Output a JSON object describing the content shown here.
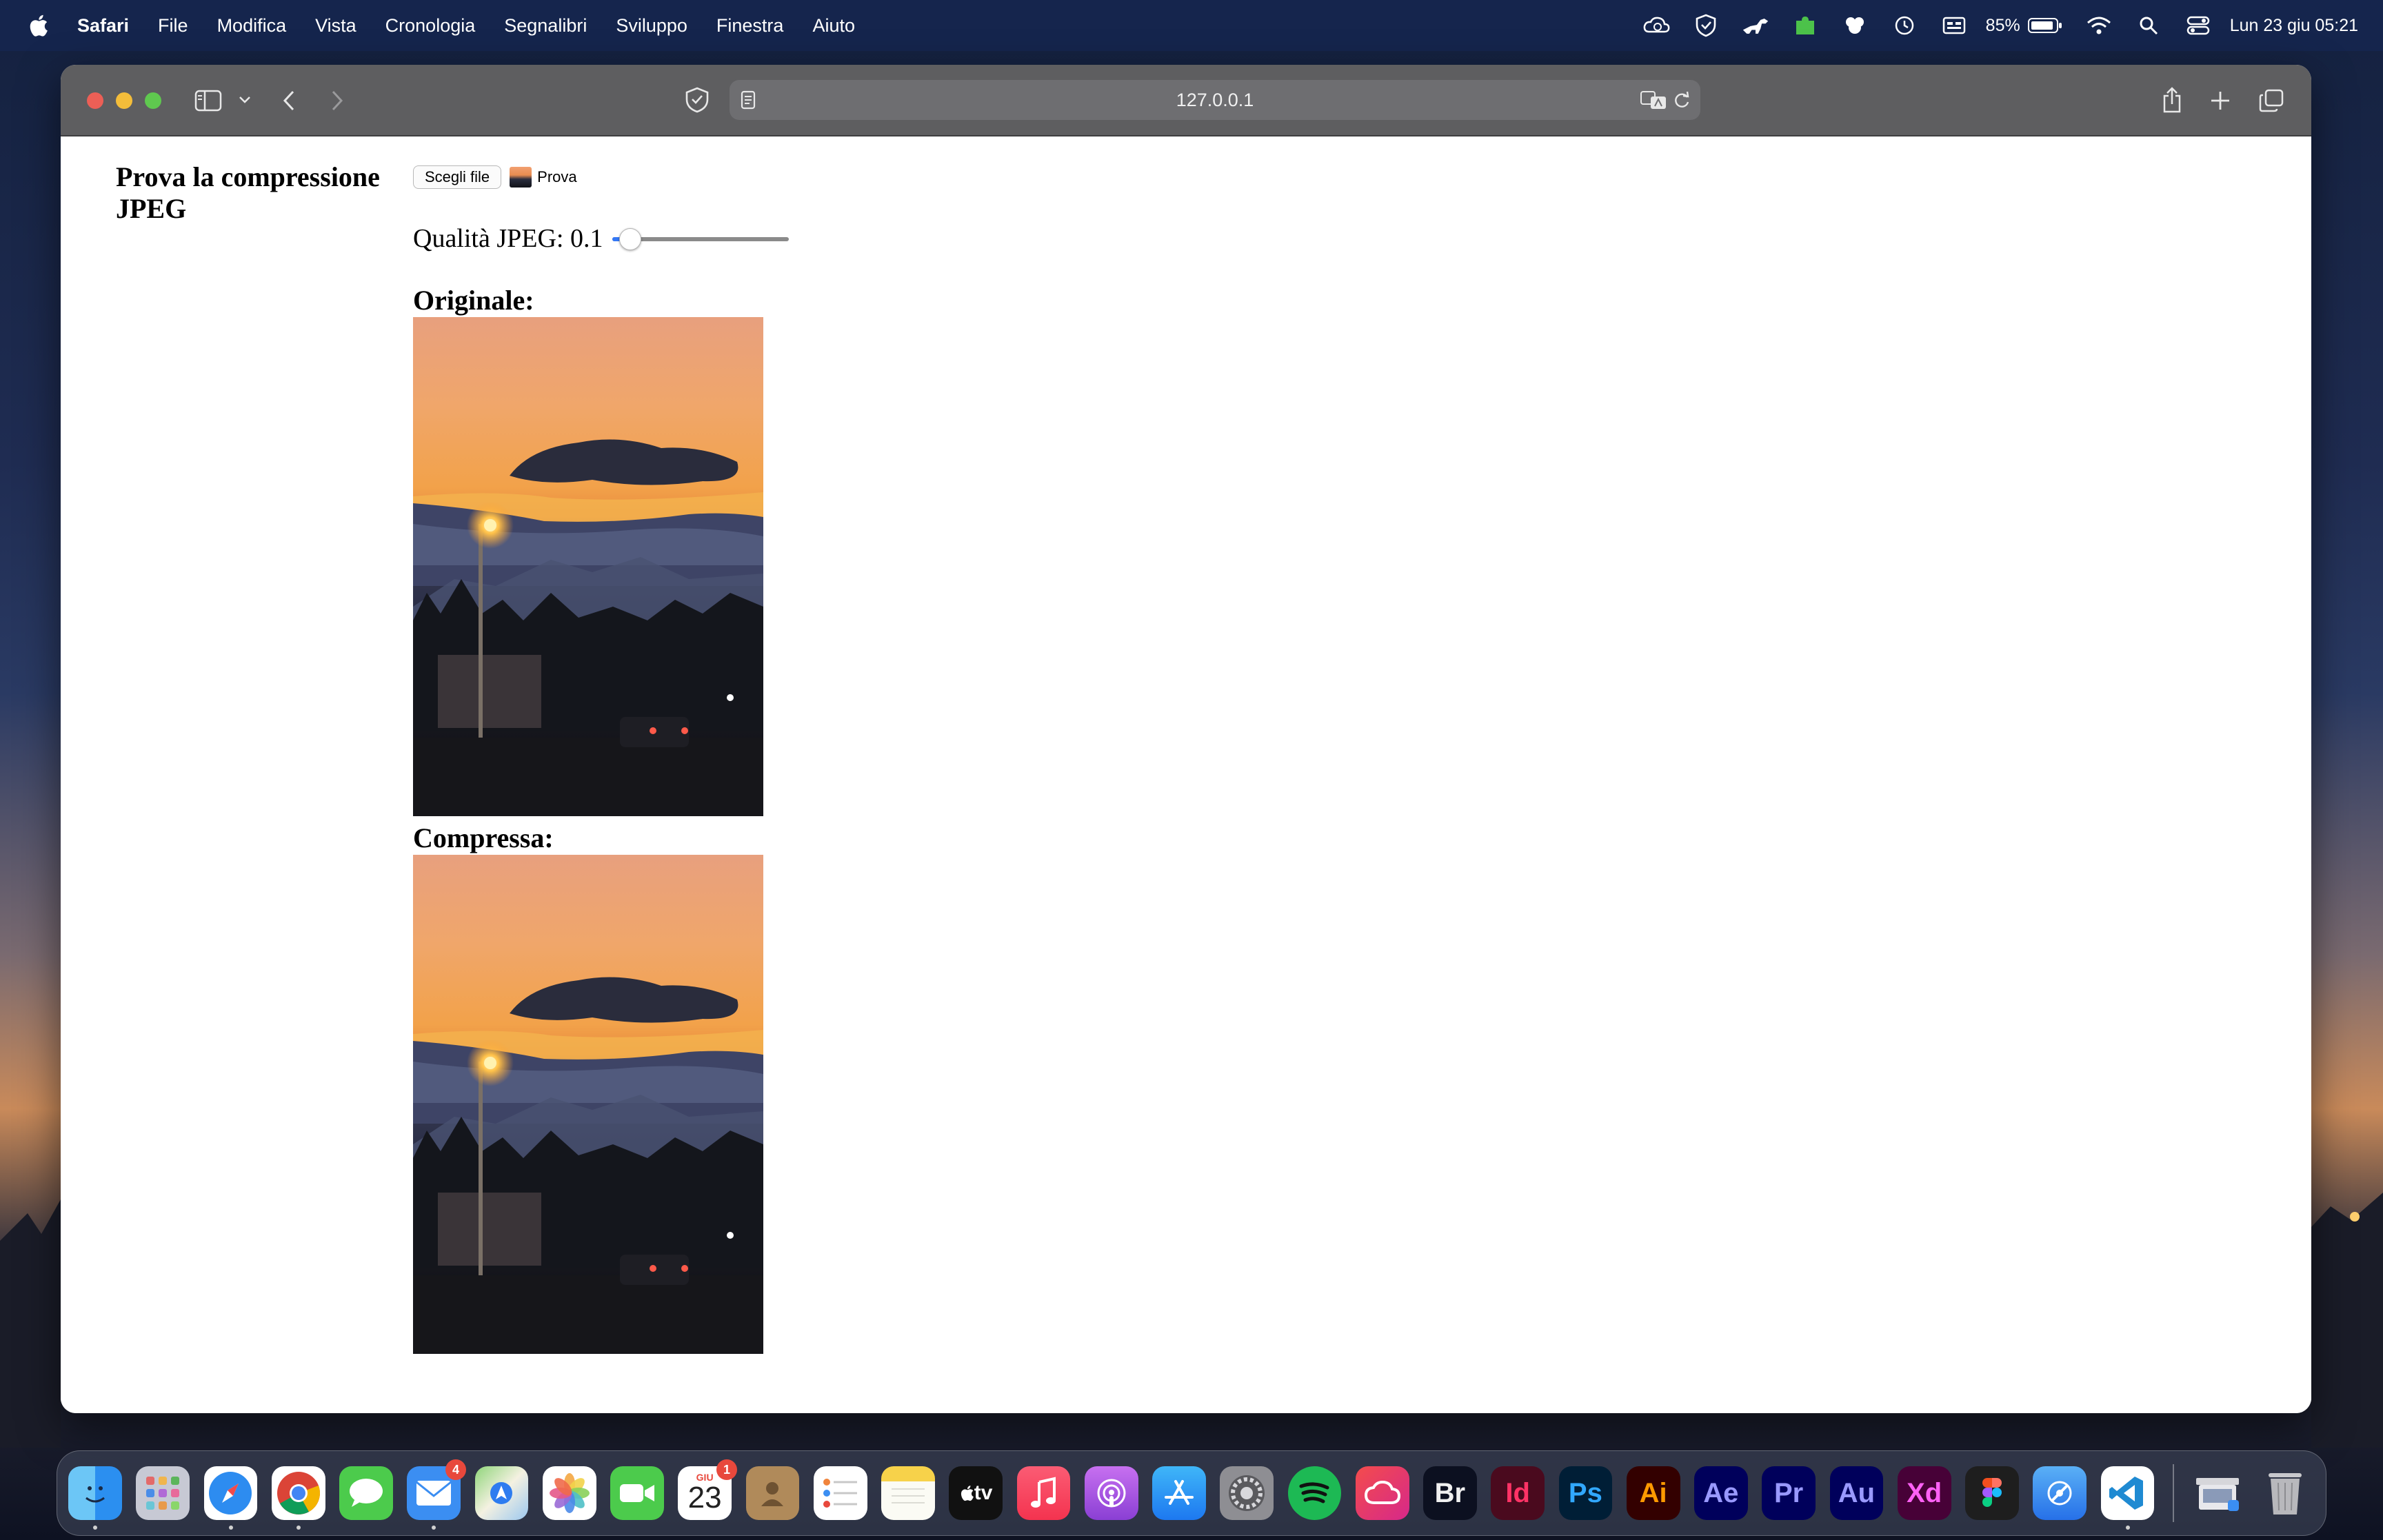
{
  "menubar": {
    "app_name": "Safari",
    "menus": [
      "File",
      "Modifica",
      "Vista",
      "Cronologia",
      "Segnalibri",
      "Sviluppo",
      "Finestra",
      "Aiuto"
    ],
    "battery": "85%",
    "clock": "Lun 23 giu  05:21"
  },
  "browser": {
    "url": "127.0.0.1"
  },
  "page": {
    "title": "Prova la compressione JPEG",
    "choose_file_label": "Scegli file",
    "file_name": "Prova",
    "quality_label": "Qualità JPEG: 0.1",
    "quality_value": 0.1,
    "original_heading": "Originale:",
    "compressed_heading": "Compressa:"
  },
  "dock": {
    "mail_badge": "4",
    "calendar_month": "GIU",
    "calendar_day": "23",
    "calendar_badge": "1",
    "tv_label": "tv",
    "adobe_apps": [
      "Br",
      "Id",
      "Ps",
      "Ai",
      "Ae",
      "Pr",
      "Au",
      "Xd"
    ]
  },
  "colors": {
    "safari_toolbar": "#5e5e60",
    "slider_accent": "#3478f6",
    "menubar": "#16264e"
  }
}
